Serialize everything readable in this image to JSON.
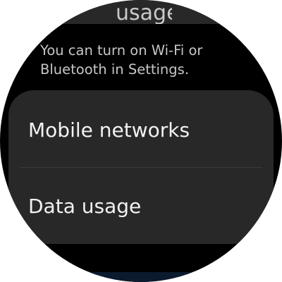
{
  "top_card": {
    "label": "usage"
  },
  "info": {
    "line1": "You can turn on Wi-Fi or",
    "line2": "Bluetooth in Settings."
  },
  "settings": {
    "items": [
      {
        "label": "Mobile networks"
      },
      {
        "label": "Data usage"
      }
    ]
  }
}
